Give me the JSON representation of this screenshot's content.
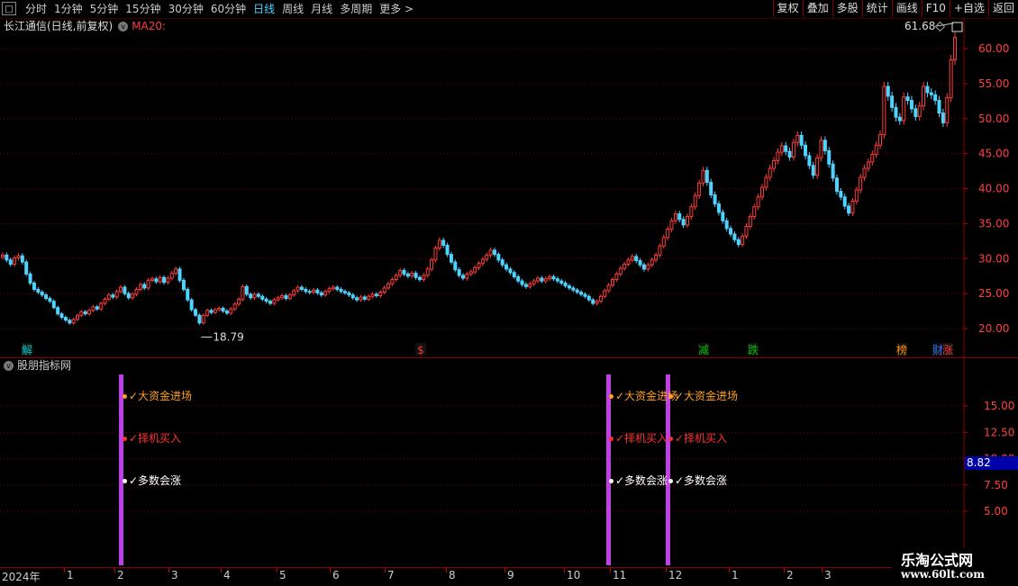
{
  "toolbar": {
    "back_icon": "square-back-icon",
    "periods": [
      "分时",
      "1分钟",
      "5分钟",
      "15分钟",
      "30分钟",
      "60分钟",
      "日线",
      "周线",
      "月线",
      "多周期",
      "更多 >"
    ],
    "active_period": "日线",
    "right_buttons": [
      "复权",
      "叠加",
      "多股",
      "统计",
      "画线",
      "F10",
      "+自选",
      "返回"
    ]
  },
  "stock": {
    "title": "长江通信(日线,前复权)",
    "ma_label": "MA20:"
  },
  "price_axis": {
    "ticks": [
      "60.00",
      "55.00",
      "50.00",
      "45.00",
      "40.00",
      "35.00",
      "30.00",
      "25.00",
      "20.00"
    ]
  },
  "annotations": {
    "high": "61.68",
    "low": "18.79"
  },
  "event_markers": [
    {
      "text": "解",
      "color": "#00c8c8"
    },
    {
      "text": "$",
      "color": "#ff3030"
    },
    {
      "text": "减",
      "color": "#00c000"
    },
    {
      "text": "跌",
      "color": "#00c000"
    },
    {
      "text": "榜",
      "color": "#ff8c00"
    },
    {
      "text": "财",
      "color": "#3070ff"
    },
    {
      "text": "涨",
      "color": "#ff3030"
    }
  ],
  "indicator": {
    "title": "股朋指标网",
    "ticks": [
      "15.00",
      "12.50",
      "10.00",
      "7.50",
      "5.00"
    ],
    "current_value": "8.82",
    "signals": [
      {
        "big": "✓大资金进场",
        "buy": "✓择机买入",
        "rise": "✓多数会涨"
      },
      {
        "big": "✓大资金进场",
        "buy": "✓择机买入",
        "rise": "✓多数会涨"
      },
      {
        "big": "✓大资金进场",
        "buy": "✓择机买入",
        "rise": "✓多数会涨"
      }
    ]
  },
  "date_axis": [
    "2024年",
    "1",
    "2",
    "3",
    "4",
    "5",
    "6",
    "7",
    "8",
    "9",
    "10",
    "11",
    "12",
    "1",
    "2",
    "3"
  ],
  "watermark": {
    "line1": "乐淘公式网",
    "line2": "www.60lt.com"
  },
  "colors": {
    "up": "#ff3c3c",
    "down": "#4fd3ff",
    "signal_line": "#c040e8",
    "grid": "#7a0000"
  },
  "chart_data": {
    "type": "candlestick",
    "y_range": [
      17,
      64
    ],
    "closes": [
      30.5,
      29.8,
      29.2,
      30.1,
      30.4,
      29.5,
      27.8,
      26.5,
      25.6,
      25.2,
      24.8,
      24.3,
      23.9,
      23.0,
      22.1,
      21.6,
      21.2,
      20.8,
      21.3,
      21.9,
      22.4,
      22.1,
      22.6,
      23.1,
      22.8,
      23.6,
      24.2,
      24.8,
      24.5,
      25.3,
      25.9,
      25.0,
      24.4,
      24.9,
      25.6,
      26.3,
      25.8,
      26.9,
      27.1,
      26.7,
      27.3,
      26.6,
      27.2,
      27.9,
      28.5,
      26.9,
      25.6,
      24.1,
      22.7,
      21.9,
      20.8,
      21.9,
      22.6,
      22.3,
      22.7,
      22.9,
      22.5,
      22.2,
      22.8,
      23.5,
      24.2,
      26.0,
      24.9,
      24.4,
      24.9,
      24.6,
      24.2,
      23.9,
      23.6,
      24.1,
      24.4,
      24.7,
      24.3,
      24.8,
      25.4,
      25.9,
      25.6,
      25.3,
      25.2,
      25.5,
      25.1,
      24.8,
      25.3,
      25.7,
      25.9,
      25.6,
      25.3,
      25.1,
      24.8,
      24.4,
      24.1,
      24.5,
      24.2,
      24.6,
      24.9,
      24.7,
      25.2,
      25.8,
      26.4,
      27.0,
      27.6,
      28.3,
      27.8,
      27.5,
      27.9,
      27.3,
      27.0,
      27.6,
      28.5,
      29.8,
      31.5,
      32.6,
      31.9,
      30.6,
      29.5,
      28.4,
      27.6,
      27.2,
      27.8,
      28.1,
      28.7,
      29.3,
      29.9,
      30.5,
      31.2,
      30.6,
      29.8,
      29.1,
      28.5,
      28.0,
      27.4,
      26.8,
      26.3,
      26.0,
      26.4,
      26.8,
      27.2,
      26.8,
      27.1,
      27.4,
      27.1,
      26.8,
      26.5,
      26.1,
      25.8,
      25.5,
      25.2,
      24.9,
      24.6,
      24.1,
      23.6,
      23.9,
      24.6,
      25.4,
      26.2,
      27.0,
      27.8,
      28.6,
      29.2,
      29.8,
      30.3,
      29.7,
      29.1,
      28.5,
      29.1,
      29.8,
      30.5,
      31.8,
      33.0,
      34.2,
      35.4,
      36.4,
      35.6,
      34.8,
      36.0,
      37.4,
      39.0,
      40.8,
      42.6,
      40.9,
      39.1,
      37.8,
      36.6,
      35.4,
      34.3,
      33.5,
      32.7,
      32.0,
      33.2,
      34.6,
      36.0,
      37.4,
      38.8,
      40.2,
      41.6,
      42.9,
      44.0,
      45.2,
      46.1,
      45.3,
      44.5,
      46.6,
      47.6,
      46.2,
      44.7,
      43.3,
      41.9,
      44.4,
      46.9,
      45.4,
      43.5,
      41.5,
      39.6,
      38.8,
      37.5,
      36.5,
      38.2,
      39.8,
      41.6,
      42.9,
      43.8,
      44.9,
      46.2,
      47.7,
      54.6,
      53.2,
      51.6,
      50.2,
      49.7,
      53.1,
      52.6,
      51.4,
      50.3,
      51.8,
      54.6,
      53.7,
      53.4,
      52.6,
      50.8,
      49.4,
      53.0,
      58.4,
      61.6
    ]
  }
}
